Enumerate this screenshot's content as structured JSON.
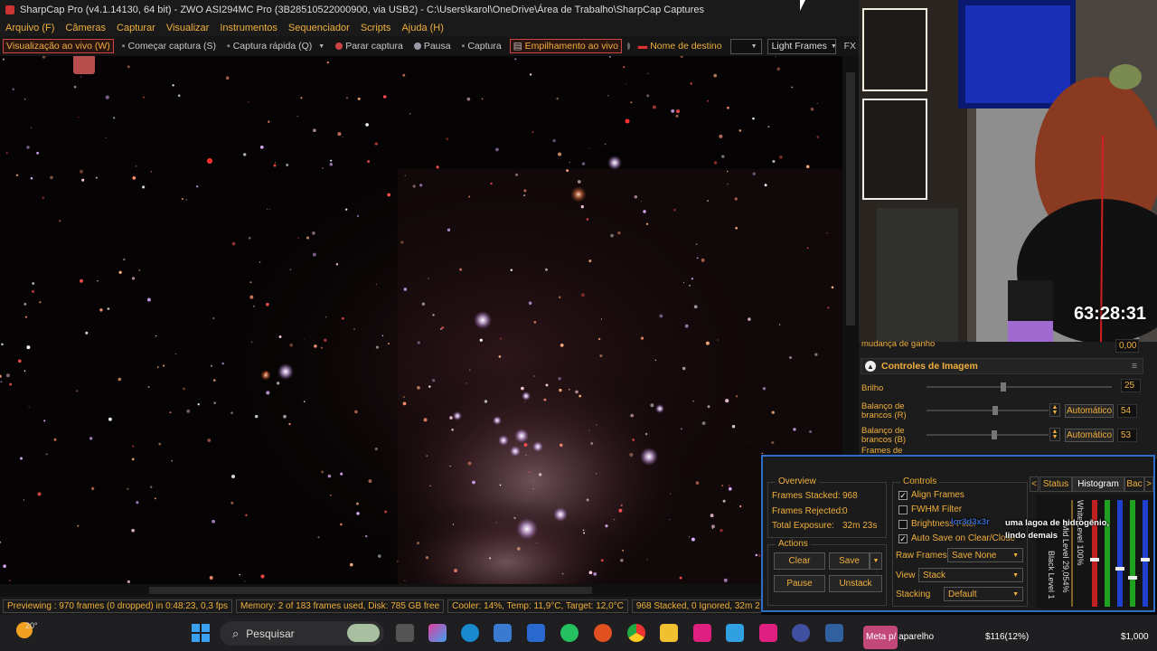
{
  "window": {
    "title": "SharpCap Pro (v4.1.14130, 64 bit) - ZWO ASI294MC Pro (3B28510522000900, via USB2) - C:\\Users\\karol\\OneDrive\\Área de Trabalho\\SharpCap Captures"
  },
  "menu": [
    "Arquivo (F)",
    "Câmeras",
    "Capturar",
    "Visualizar",
    "Instrumentos",
    "Sequenciador",
    "Scripts",
    "Ajuda (H)"
  ],
  "toolbar": {
    "live_view": "Visualização ao vivo (W)",
    "start_capture": "Começar captura (S)",
    "quick_capture": "Captura rápida (Q)",
    "stop_capture": "Parar captura",
    "pause": "Pausa",
    "capture": "Captura",
    "live_stack": "Empilhamento ao vivo",
    "target_name": "Nome de destino",
    "target_value": "",
    "frame_type": "Light Frames",
    "fx": "FX"
  },
  "statusbar": {
    "preview": "Previewing : 970 frames (0 dropped) in 0:48:23, 0,3 fps",
    "memory": "Memory: 2 of 183 frames used, Disk: 785 GB free",
    "cooler": "Cooler: 14%, Temp: 11,9°C, Target: 12,0°C",
    "stack": "968 Stacked, 0 Ignored, 32m 2"
  },
  "overlay": {
    "timer": "63:28:31"
  },
  "controls": {
    "partial_label": "mudança de ganho",
    "partial_value": "0,00",
    "section_title": "Controles de Imagem",
    "brightness": {
      "label": "Brilho",
      "value": "25",
      "level": 0.4
    },
    "wb_r": {
      "label": "Balanço de brancos (R)",
      "value": "54",
      "auto": "Automático",
      "level": 0.54
    },
    "wb_b": {
      "label": "Balanço de brancos (B)",
      "value": "53",
      "auto": "Automático",
      "level": 0.53
    },
    "partial_next": "Frames de"
  },
  "live_stack": {
    "overview_title": "Overview",
    "frames_stacked_label": "Frames Stacked:",
    "frames_stacked": "968",
    "frames_rejected_label": "Frames Rejected:",
    "frames_rejected": "0",
    "total_exposure_label": "Total Exposure:",
    "total_exposure": "32m 23s",
    "actions_title": "Actions",
    "clear": "Clear",
    "save": "Save",
    "pause": "Pause",
    "unstack": "Unstack",
    "controls_title": "Controls",
    "align_frames": "Align Frames",
    "fwhm_filter": "FWHM Filter",
    "brightness_filter": "Brightness Filter",
    "auto_save": "Auto Save on Clear/Close",
    "raw_frames_label": "Raw Frames",
    "raw_frames_value": "Save None",
    "view_label": "View",
    "view_value": "Stack",
    "stacking_label": "Stacking",
    "stacking_value": "Default",
    "tabs": [
      "Status",
      "Histogram",
      "Bac"
    ],
    "hist_labels": [
      "White Level 100%",
      "Mid Level 29,054%",
      "Black Level 1"
    ]
  },
  "chat": {
    "user": "lor3d3x3r",
    "message": "uma lagoa de hidrogênio, lindo demais"
  },
  "taskbar": {
    "weather": "20°",
    "search_placeholder": "Pesquisar",
    "meta_text": "Meta p/ aparelho",
    "amount": "$116(12%)",
    "goal": "$1,000"
  }
}
